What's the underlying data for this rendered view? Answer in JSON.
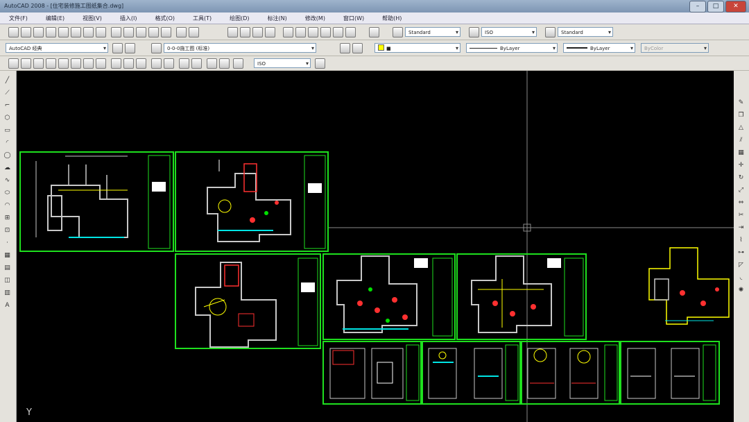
{
  "window": {
    "title": "AutoCAD 2008 - [住宅装修施工图纸集合.dwg]",
    "minimize": "–",
    "maximize": "□",
    "close": "✕"
  },
  "menu": [
    "文件(F)",
    "编辑(E)",
    "视图(V)",
    "插入(I)",
    "格式(O)",
    "工具(T)",
    "绘图(D)",
    "标注(N)",
    "修改(M)",
    "窗口(W)",
    "帮助(H)"
  ],
  "toolbar": {
    "text_style": "Standard",
    "dim_style": "ISO",
    "table_style": "Standard",
    "workspace": "AutoCAD 经典",
    "layer": "0-0-0施工图 (标准)",
    "color": "■",
    "linetype": "ByLayer",
    "lineweight": "ByLayer",
    "plotstyle": "ByColor",
    "dim_combo": "ISO"
  },
  "canvas": {
    "ucs_label": "Y"
  },
  "colors": {
    "frame": "#1ee01e",
    "bg": "#000000",
    "crosshair": "#8a8a8a"
  }
}
